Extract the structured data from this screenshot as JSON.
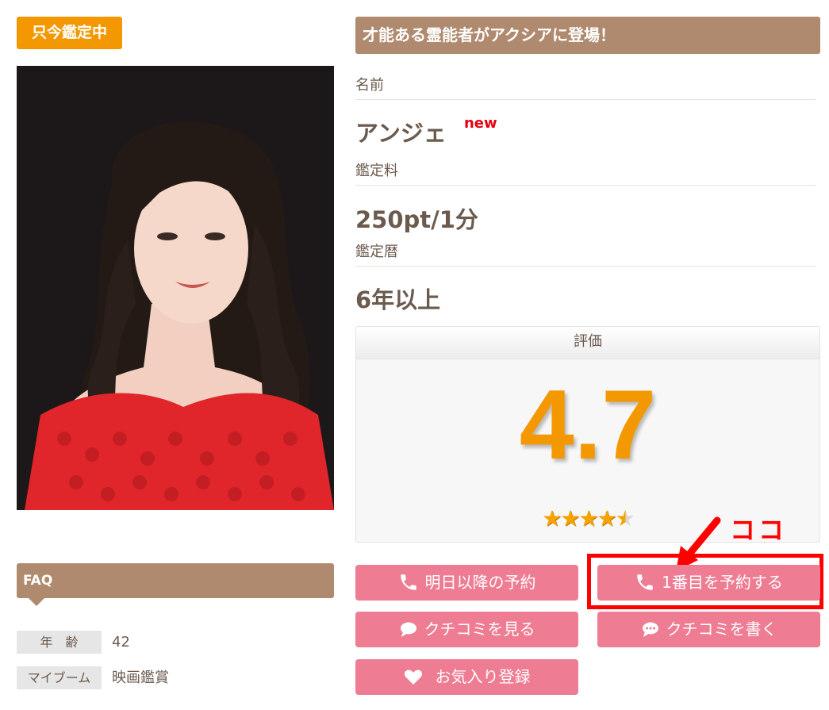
{
  "status_badge": "只今鑑定中",
  "headline": "才能ある霊能者がアクシアに登場！",
  "profile": {
    "name_label": "名前",
    "name": "アンジェ",
    "new_tag": "new",
    "fee_label": "鑑定料",
    "fee": "250pt/1分",
    "career_label": "鑑定暦",
    "career": "6年以上"
  },
  "rating": {
    "label": "評価",
    "score": "4.7",
    "stars_value": 4.7,
    "stars_max": 5
  },
  "buttons": {
    "reserve_later": "明日以降の予約",
    "reserve_first": "1番目を予約する",
    "view_reviews": "クチコミを見る",
    "write_review": "クチコミを書く",
    "favorite": "お気入り登録"
  },
  "annotation": {
    "text": "ココ"
  },
  "faq": {
    "title": "FAQ",
    "rows": [
      {
        "label": "年　齢",
        "value": "42"
      },
      {
        "label": "マイブーム",
        "value": "映画鑑賞"
      }
    ]
  },
  "colors": {
    "accent_brown": "#b08a6e",
    "badge_orange": "#f39800",
    "button_pink": "#ee7c93",
    "annotation_red": "#ff0000"
  }
}
